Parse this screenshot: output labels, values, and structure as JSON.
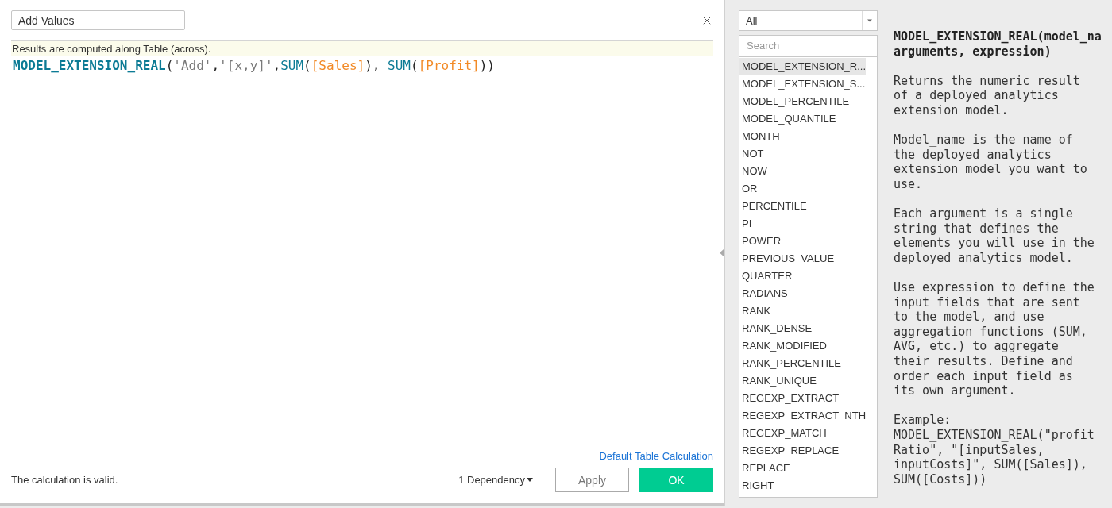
{
  "name_field": {
    "value": "Add Values"
  },
  "hint": "Results are computed along Table (across).",
  "formula": [
    {
      "text": "MODEL_EXTENSION_REAL",
      "kind": "function"
    },
    {
      "text": "(",
      "kind": "punct"
    },
    {
      "text": "'Add'",
      "kind": "string"
    },
    {
      "text": ",",
      "kind": "punct"
    },
    {
      "text": "'[x,y]'",
      "kind": "string"
    },
    {
      "text": ",",
      "kind": "punct"
    },
    {
      "text": "SUM",
      "kind": "aggregate"
    },
    {
      "text": "(",
      "kind": "punct"
    },
    {
      "text": "[Sales]",
      "kind": "field"
    },
    {
      "text": "), ",
      "kind": "punct"
    },
    {
      "text": "SUM",
      "kind": "aggregate"
    },
    {
      "text": "(",
      "kind": "punct"
    },
    {
      "text": "[Profit]",
      "kind": "field"
    },
    {
      "text": "))",
      "kind": "punct"
    }
  ],
  "default_table_calculation_link": "Default Table Calculation",
  "status": "The calculation is valid.",
  "dependency_menu": "1 Dependency",
  "buttons": [
    {
      "label": "Apply",
      "kind": "secondary"
    },
    {
      "label": "OK",
      "kind": "primary"
    }
  ],
  "function_panel": {
    "category": "All",
    "search": {
      "placeholder": "Search"
    },
    "functions": [
      {
        "name": "MODEL_EXTENSION_R...",
        "selected": true
      },
      {
        "name": "MODEL_EXTENSION_S...",
        "selected": false
      },
      {
        "name": "MODEL_PERCENTILE",
        "selected": false
      },
      {
        "name": "MODEL_QUANTILE",
        "selected": false
      },
      {
        "name": "MONTH",
        "selected": false
      },
      {
        "name": "NOT",
        "selected": false
      },
      {
        "name": "NOW",
        "selected": false
      },
      {
        "name": "OR",
        "selected": false
      },
      {
        "name": "PERCENTILE",
        "selected": false
      },
      {
        "name": "PI",
        "selected": false
      },
      {
        "name": "POWER",
        "selected": false
      },
      {
        "name": "PREVIOUS_VALUE",
        "selected": false
      },
      {
        "name": "QUARTER",
        "selected": false
      },
      {
        "name": "RADIANS",
        "selected": false
      },
      {
        "name": "RANK",
        "selected": false
      },
      {
        "name": "RANK_DENSE",
        "selected": false
      },
      {
        "name": "RANK_MODIFIED",
        "selected": false
      },
      {
        "name": "RANK_PERCENTILE",
        "selected": false
      },
      {
        "name": "RANK_UNIQUE",
        "selected": false
      },
      {
        "name": "REGEXP_EXTRACT",
        "selected": false
      },
      {
        "name": "REGEXP_EXTRACT_NTH",
        "selected": false
      },
      {
        "name": "REGEXP_MATCH",
        "selected": false
      },
      {
        "name": "REGEXP_REPLACE",
        "selected": false
      },
      {
        "name": "REPLACE",
        "selected": false
      },
      {
        "name": "RIGHT",
        "selected": false
      }
    ],
    "description": {
      "title_lines": [
        "MODEL_EXTENSION_REAL(model_na",
        "arguments, expression)"
      ],
      "paragraphs": [
        "Returns the numeric result of a deployed analytics extension model.",
        "Model_name is the name of the deployed analytics extension model you want to use.",
        "Each argument is a single string that defines the elements you will use in the deployed analytics model.",
        "Use expression to define the input fields that are sent to the model, and use aggregation functions (SUM, AVG, etc.) to aggregate their results. Define and order each input field as its own argument.",
        "Example:\nMODEL_EXTENSION_REAL(\"profit Ratio\", \"[inputSales, inputCosts]\", SUM([Sales]), SUM([Costs]))"
      ]
    }
  }
}
